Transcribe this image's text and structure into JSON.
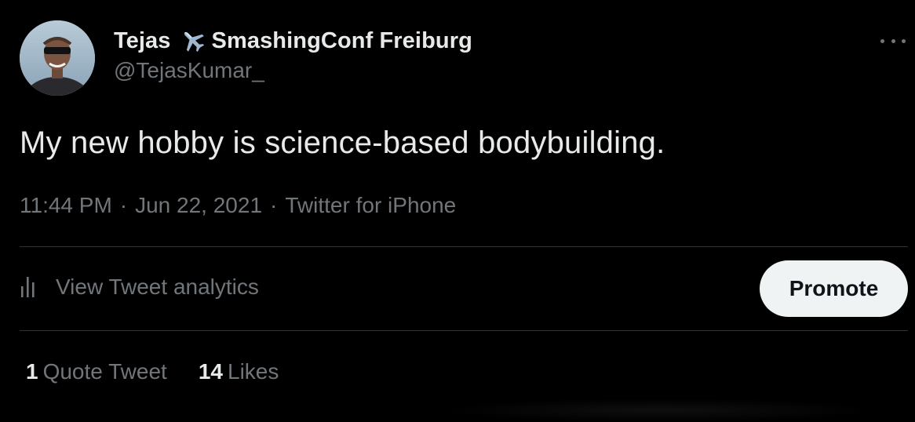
{
  "tweet": {
    "author": {
      "display_name_first": "Tejas",
      "display_name_rest": "SmashingConf Freiburg",
      "handle": "@TejasKumar_",
      "name_icon": "airplane-icon"
    },
    "more_icon": "more-dots-icon",
    "text": "My new hobby is science-based bodybuilding.",
    "meta": {
      "time": "11:44 PM",
      "separator": "·",
      "date": "Jun 22, 2021",
      "source": "Twitter for iPhone"
    },
    "analytics": {
      "icon": "analytics-bars-icon",
      "label": "View Tweet analytics"
    },
    "promote_label": "Promote",
    "stats": [
      {
        "count": "1",
        "label": "Quote Tweet"
      },
      {
        "count": "14",
        "label": "Likes"
      }
    ]
  },
  "colors": {
    "background": "#000000",
    "primary_text": "#e7e9ea",
    "secondary_text": "#71767b",
    "divider": "#2f3336",
    "promote_bg": "#eff3f4"
  }
}
